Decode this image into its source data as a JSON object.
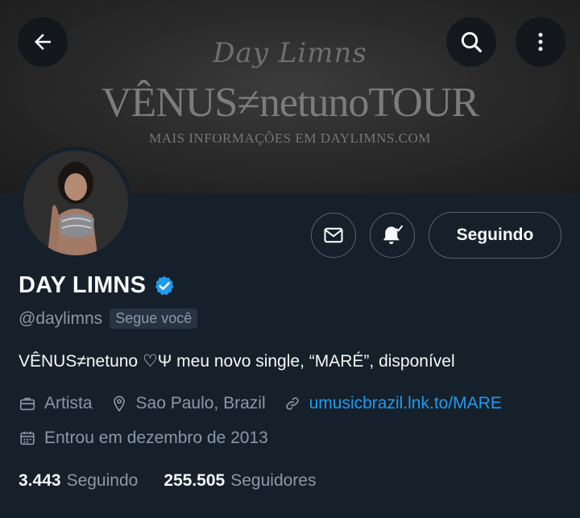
{
  "banner": {
    "script_text": "Day Limns",
    "title": "VÊNUS≠netunoTOUR",
    "subtitle": "MAIS INFORMAÇÕES EM DAYLIMNS.COM"
  },
  "top_bar": {
    "back_icon": "arrow-left-icon",
    "search_icon": "search-icon",
    "more_icon": "more-vertical-icon"
  },
  "profile": {
    "name": "DAY LIMNS",
    "verified": true,
    "handle": "@daylimns",
    "follows_you": "Segue você",
    "bio": "VÊNUS≠netuno ♡Ψ  meu novo single, “MARÉ”, disponível",
    "category": "Artista",
    "location": "Sao Paulo, Brazil",
    "website": "umusicbrazil.lnk.to/MARE",
    "joined": "Entrou em dezembro de 2013",
    "following_count": "3.443",
    "following_label": "Seguindo",
    "followers_count": "255.505",
    "followers_label": "Seguidores"
  },
  "actions": {
    "message_icon": "mail-icon",
    "notifications_icon": "bell-check-icon",
    "follow_label": "Seguindo"
  },
  "colors": {
    "background": "#15202b",
    "text": "#f7f9f9",
    "secondary_text": "#8b98a5",
    "accent": "#1d9bf0",
    "border": "#536471",
    "badge_bg": "#273340"
  }
}
